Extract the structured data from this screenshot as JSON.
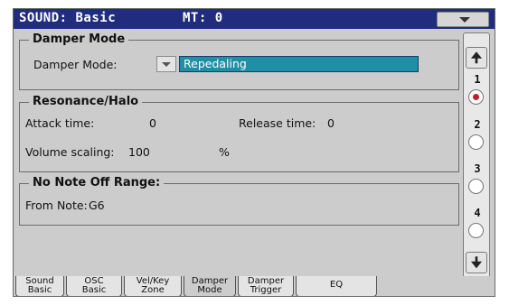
{
  "header": {
    "title": "SOUND: Basic",
    "mt": "MT: 0"
  },
  "damper_mode": {
    "legend": "Damper Mode",
    "field_label": "Damper Mode:",
    "value": "Repedaling"
  },
  "resonance": {
    "legend": "Resonance/Halo",
    "attack_label": "Attack time:",
    "attack_value": "0",
    "release_label": "Release time:",
    "release_value": "0",
    "volume_label": "Volume scaling:",
    "volume_value": "100",
    "volume_unit": "%"
  },
  "no_note_off": {
    "legend": "No Note Off Range:",
    "from_label": "From Note:",
    "from_value": "G6"
  },
  "pages": {
    "labels": [
      "1",
      "2",
      "3",
      "4"
    ],
    "selected": "1"
  },
  "icons": {
    "menu": "chevron-down-icon",
    "scroll_up": "arrow-up-icon",
    "scroll_down": "arrow-down-icon"
  },
  "colors": {
    "title_bar": "#1f2d7c",
    "selected_field": "#1f8fa5",
    "selected_radio": "#c0202a"
  },
  "tabs": [
    {
      "line1": "Sound",
      "line2": "Basic"
    },
    {
      "line1": "OSC",
      "line2": "Basic"
    },
    {
      "line1": "Vel/Key",
      "line2": "Zone"
    },
    {
      "line1": "Damper",
      "line2": "Mode"
    },
    {
      "line1": "Damper",
      "line2": "Trigger"
    },
    {
      "line1": "EQ",
      "line2": ""
    }
  ],
  "active_tab": "Damper Mode"
}
